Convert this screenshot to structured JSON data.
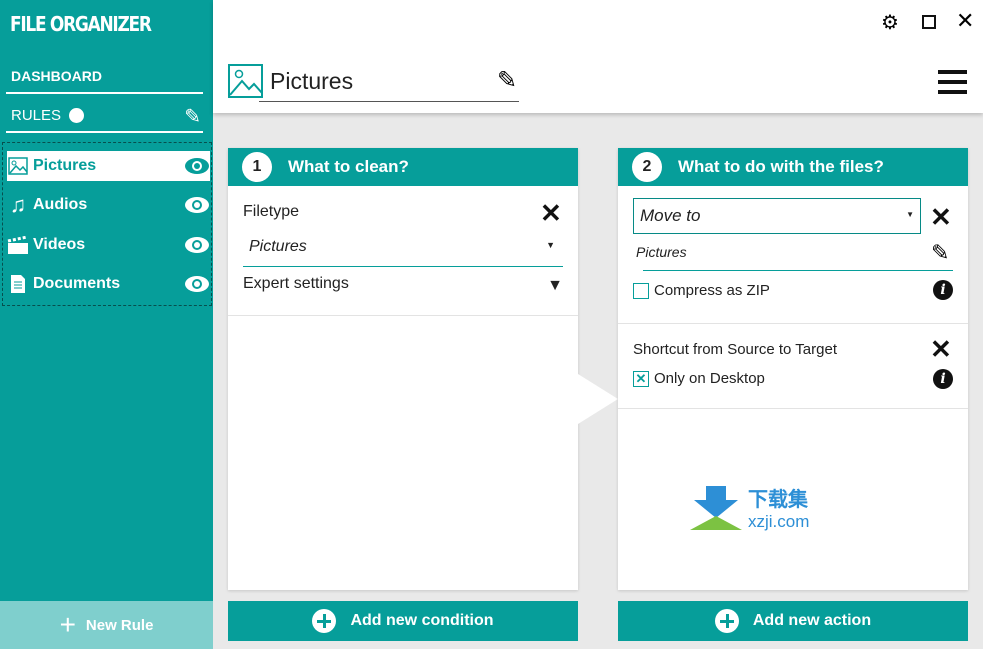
{
  "app": {
    "title": "FILE ORGANIZER"
  },
  "sidebar": {
    "dashboard": "DASHBOARD",
    "rules": "RULES",
    "new_rule": "New Rule",
    "items": [
      {
        "label": "Pictures",
        "icon": "image-icon"
      },
      {
        "label": "Audios",
        "icon": "music-icon"
      },
      {
        "label": "Videos",
        "icon": "clapperboard-icon"
      },
      {
        "label": "Documents",
        "icon": "document-icon"
      }
    ]
  },
  "header": {
    "rule_name": "Pictures"
  },
  "conditions": {
    "number": "1",
    "title": "What to clean?",
    "filetype_label": "Filetype",
    "filetype_value": "Pictures",
    "expert": "Expert settings",
    "add": "Add new condition"
  },
  "actions": {
    "number": "2",
    "title": "What to do with the files?",
    "action_value": "Move to",
    "target": "Pictures",
    "compress": "Compress as ZIP",
    "compress_checked": false,
    "shortcut": "Shortcut from Source to Target",
    "desktop": "Only on Desktop",
    "desktop_checked": true,
    "add": "Add new action"
  },
  "watermark": {
    "cn": "下载集",
    "site": "xzji.com"
  },
  "colors": {
    "accent": "#069e9a",
    "accent_light": "#7fcfcd"
  }
}
